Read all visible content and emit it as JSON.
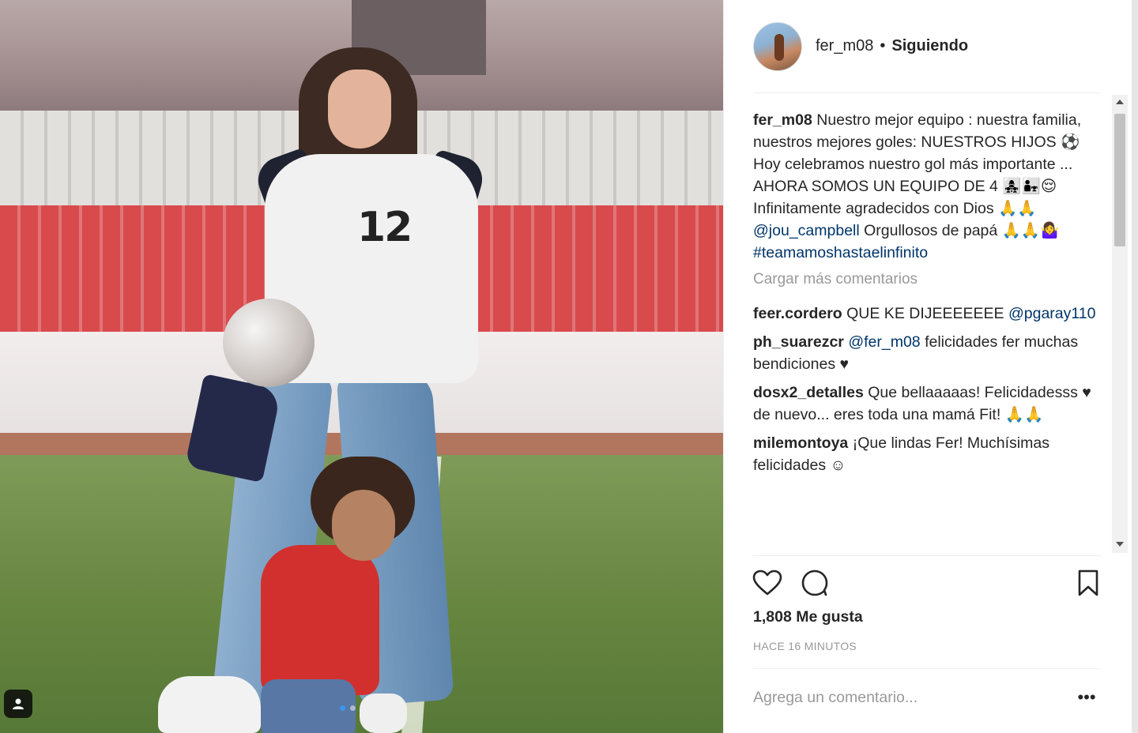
{
  "post": {
    "username": "fer_m08",
    "separator": "•",
    "follow_status": "Siguiendo",
    "likes": "1,808 Me gusta",
    "time_ago": "HACE 16 MINUTOS",
    "photo_number": "12"
  },
  "caption": {
    "author": "fer_m08",
    "text_1": " Nuestro mejor equipo : nuestra familia,",
    "text_2": "nuestros mejores goles: NUESTROS HIJOS ⚽ Hoy celebramos nuestro gol más importante ... AHORA SOMOS UN EQUIPO DE 4 👩‍👧‍👧👨‍👧😌 Infinitamente agradecidos con Dios 🙏🙏 ",
    "mention": "@jou_campbell",
    "text_3": " Orgullosos de papá 🙏🙏🤷‍♀️ ",
    "hashtag": "#teamamoshastaelinfinito"
  },
  "load_more": "Cargar más comentarios",
  "comments": [
    {
      "author": "feer.cordero",
      "text": " QUE KE DIJEEEEEEE ",
      "mention": "@pgaray110",
      "text_after": ""
    },
    {
      "author": "ph_suarezcr",
      "text": " ",
      "mention": "@fer_m08",
      "text_after": " felicidades fer muchas bendiciones ♥"
    },
    {
      "author": "dosx2_detalles",
      "text": " Que bellaaaaas! Felicidadesss ♥ de nuevo... eres toda una mamá Fit! 🙏🙏",
      "mention": "",
      "text_after": ""
    },
    {
      "author": "milemontoya",
      "text": " ¡Que lindas Fer! Muchísimas felicidades ☺",
      "mention": "",
      "text_after": ""
    }
  ],
  "comment_input": {
    "placeholder": "Agrega un comentario..."
  },
  "more_options_label": "•••",
  "icons": {
    "like": "heart-icon",
    "comment": "comment-icon",
    "save": "bookmark-icon",
    "photo_tag": "user-tag-icon"
  },
  "colors": {
    "text": "#262626",
    "muted": "#999999",
    "link": "#003569",
    "active_dot": "#3897f0"
  }
}
